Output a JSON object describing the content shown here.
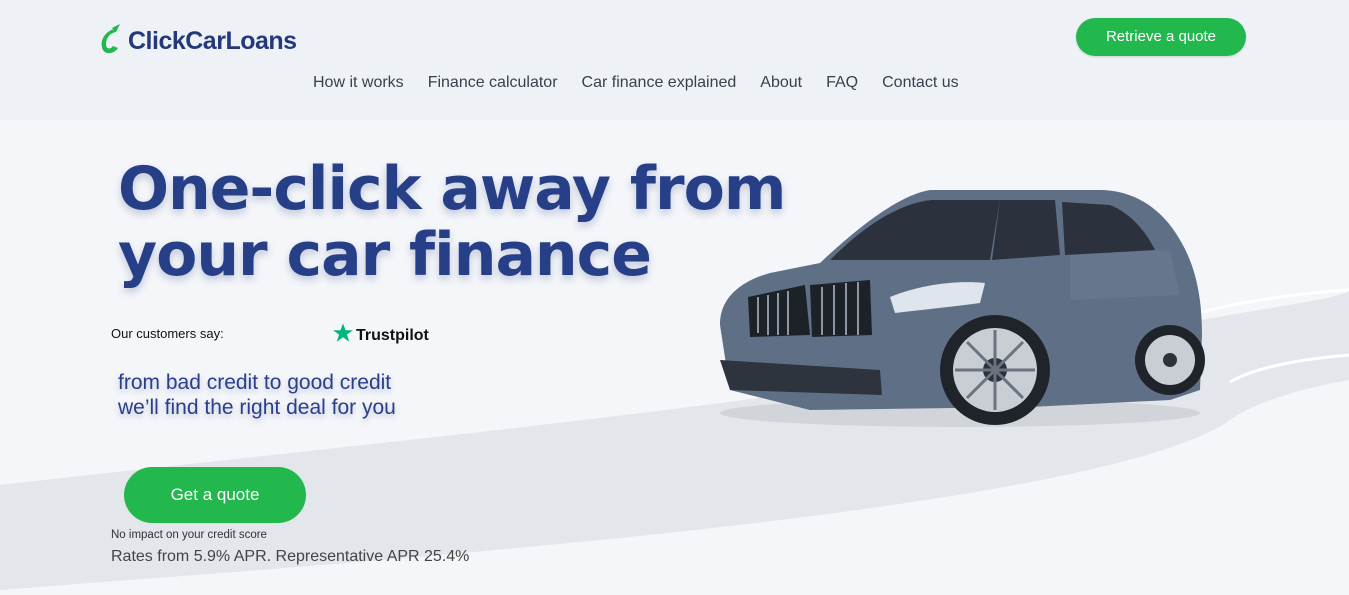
{
  "brand": {
    "name": "ClickCarLoans"
  },
  "header": {
    "retrieve_button": "Retrieve a quote",
    "nav": [
      "How it works",
      "Finance calculator",
      "Car finance explained",
      "About",
      "FAQ",
      "Contact us"
    ]
  },
  "hero": {
    "headline_line1": "One-click away from",
    "headline_line2": "your car finance",
    "customers_say": "Our customers say:",
    "trustpilot": "Trustpilot",
    "tagline_line1": "from bad credit to good credit",
    "tagline_line2": "we’ll find the right deal for you",
    "cta": "Get a quote",
    "no_impact": "No impact on your credit score",
    "rates": "Rates from 5.9% APR. Representative APR 25.4%"
  },
  "colors": {
    "brand_blue": "#263f86",
    "accent_green": "#22b84e",
    "trustpilot_green": "#00b67a"
  },
  "icons": {
    "logo": "checkmark-swoosh-icon",
    "trustpilot": "star-icon"
  }
}
